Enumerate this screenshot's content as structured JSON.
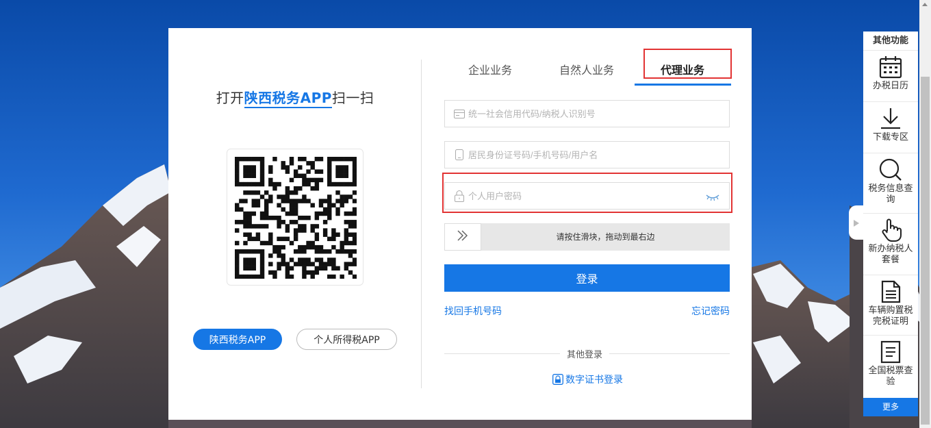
{
  "left": {
    "title_prefix": "打开",
    "title_brand": "陕西税务APP",
    "title_suffix": "扫一扫",
    "btn_app": "陕西税务APP",
    "btn_personal_tax": "个人所得税APP"
  },
  "tabs": [
    {
      "label": "企业业务"
    },
    {
      "label": "自然人业务"
    },
    {
      "label": "代理业务",
      "active": true
    }
  ],
  "form": {
    "credit_code_placeholder": "统一社会信用代码/纳税人识别号",
    "id_placeholder": "居民身份证号码/手机号码/用户名",
    "password_placeholder": "个人用户密码",
    "slider_text": "请按住滑块，拖动到最右边",
    "login_button": "登录",
    "recover_phone": "找回手机号码",
    "forgot_password": "忘记密码",
    "other_login": "其他登录",
    "cert_login": "数字证书登录"
  },
  "sidebar": {
    "title": "其他功能",
    "items": [
      {
        "label": "办税日历",
        "icon": "calendar-icon"
      },
      {
        "label": "下载专区",
        "icon": "download-icon"
      },
      {
        "label": "税务信息查询",
        "icon": "search-icon"
      },
      {
        "label": "新办纳税人套餐",
        "icon": "hand-pointer-icon"
      },
      {
        "label": "车辆购置税完税证明",
        "icon": "document-icon"
      },
      {
        "label": "全国税票查验",
        "icon": "receipt-icon"
      }
    ],
    "more": "更多"
  },
  "colors": {
    "primary": "#1677e5",
    "highlight": "#e23333"
  }
}
